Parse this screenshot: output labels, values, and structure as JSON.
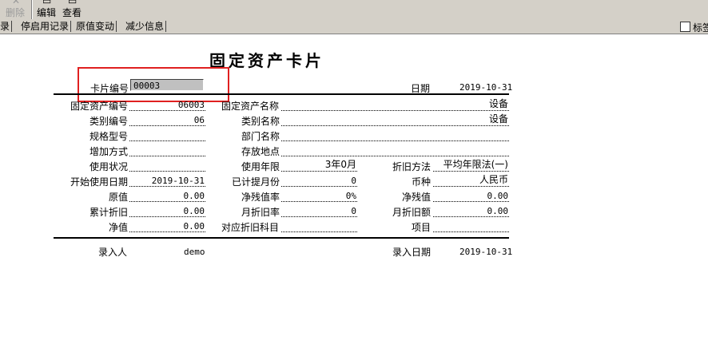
{
  "toolbar": {
    "delete_label": "删除",
    "edit_label": "编辑",
    "view_label": "查看"
  },
  "tabs": [
    {
      "label": "录"
    },
    {
      "label": "停启用记录"
    },
    {
      "label": "原值变动"
    },
    {
      "label": "减少信息"
    }
  ],
  "checkbox": {
    "label": "标签"
  },
  "card": {
    "title": "固定资产卡片",
    "card_no_label": "卡片编号",
    "card_no": "00003",
    "date_label": "日期",
    "date": "2019-10-31",
    "rows": {
      "asset_code_label": "固定资产编号",
      "asset_code": "06003",
      "asset_name_label": "固定资产名称",
      "asset_name": "设备",
      "category_code_label": "类别编号",
      "category_code": "06",
      "category_name_label": "类别名称",
      "category_name": "设备",
      "spec_label": "规格型号",
      "spec": "",
      "dept_label": "部门名称",
      "dept": "",
      "add_method_label": "增加方式",
      "add_method": "",
      "location_label": "存放地点",
      "location": "",
      "usage_label": "使用状况",
      "usage": "",
      "life_label": "使用年限",
      "life": "3年0月",
      "depr_method_label": "折旧方法",
      "depr_method": "平均年限法(一)",
      "start_date_label": "开始使用日期",
      "start_date": "2019-10-31",
      "months_label": "已计提月份",
      "months": "0",
      "currency_label": "币种",
      "currency": "人民币",
      "original_label": "原值",
      "original": "0.00",
      "residual_rate_label": "净残值率",
      "residual_rate": "0%",
      "residual_label": "净残值",
      "residual": "0.00",
      "accum_label": "累计折旧",
      "accum": "0.00",
      "monthly_rate_label": "月折旧率",
      "monthly_rate": "0",
      "monthly_amount_label": "月折旧额",
      "monthly_amount": "0.00",
      "net_label": "净值",
      "net": "0.00",
      "subject_label": "对应折旧科目",
      "subject": "",
      "project_label": "项目",
      "project": ""
    },
    "entered_by_label": "录入人",
    "entered_by": "demo",
    "entry_date_label": "录入日期",
    "entry_date": "2019-10-31"
  },
  "highlight": {
    "color": "#e02020"
  }
}
